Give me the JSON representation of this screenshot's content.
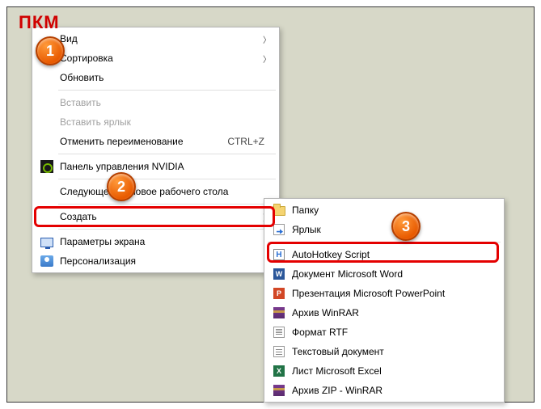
{
  "caption": "ПКМ",
  "badges": {
    "b1": "1",
    "b2": "2",
    "b3": "3"
  },
  "menu1": {
    "view": "Вид",
    "sort": "Сортировка",
    "refresh": "Обновить",
    "paste": "Вставить",
    "paste_shortcut": "Вставить ярлык",
    "undo_rename": "Отменить переименование",
    "undo_rename_key": "CTRL+Z",
    "nvidia": "Панель управления NVIDIA",
    "next_bg": "Следующее фоновое рабочего стола",
    "create": "Создать",
    "display_settings": "Параметры экрана",
    "personalize": "Персонализация"
  },
  "menu2": {
    "folder": "Папку",
    "shortcut": "Ярлык",
    "ahk": "AutoHotkey Script",
    "word": "Документ Microsoft Word",
    "ppt": "Презентация Microsoft PowerPoint",
    "rar": "Архив WinRAR",
    "rtf": "Формат RTF",
    "txt": "Текстовый документ",
    "excel": "Лист Microsoft Excel",
    "zip": "Архив ZIP - WinRAR"
  }
}
